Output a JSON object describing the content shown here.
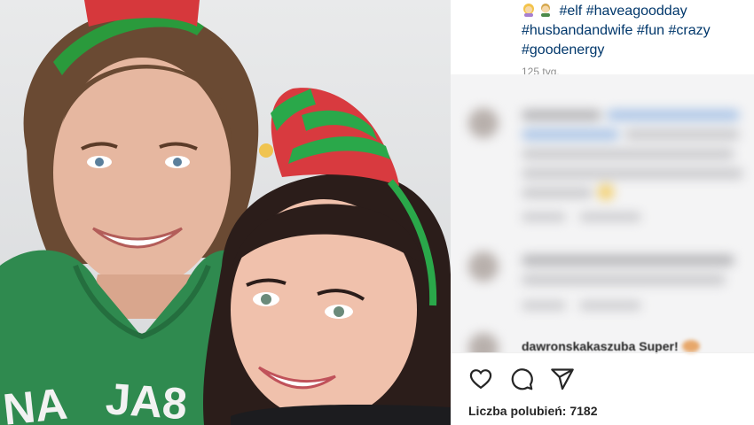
{
  "post": {
    "caption": {
      "emojis": [
        "woman-emoji",
        "man-emoji"
      ],
      "hashtags": [
        "#elf",
        "#haveagoodday",
        "#husbandandwife",
        "#fun",
        "#crazy",
        "#goodenergy"
      ]
    },
    "time_ago": "125 tyg."
  },
  "comments": {
    "last_visible_username": "dawronskakaszuba Super!"
  },
  "actions": {
    "like_icon": "heart-icon",
    "comment_icon": "comment-icon",
    "share_icon": "share-icon"
  },
  "likes": {
    "label": "Liczba polubień: 7182"
  },
  "colors": {
    "hashtag": "#00376b",
    "hoodie_green": "#2f8a4f",
    "elf_red": "#d83a3f",
    "elf_green": "#2aa84a"
  }
}
